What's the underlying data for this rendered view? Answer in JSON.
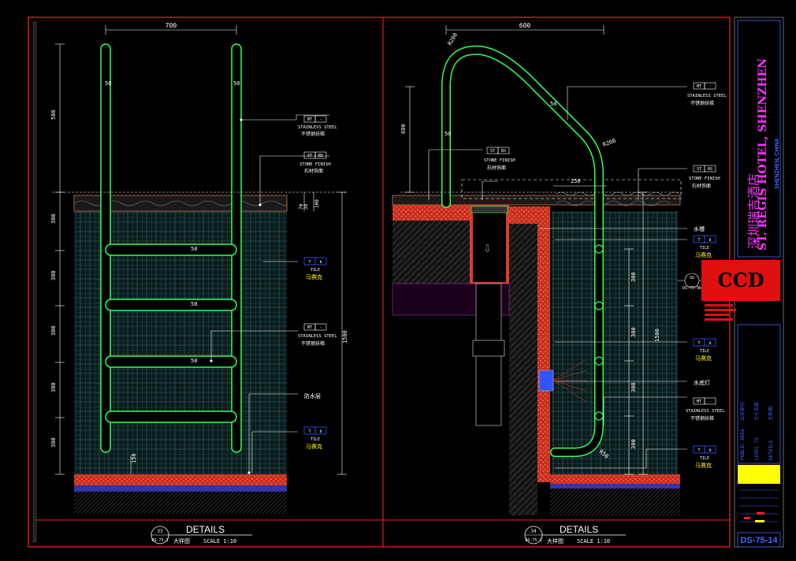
{
  "titles": {
    "left": {
      "number": "33",
      "ref": "DS-75-1",
      "name": "DETAILS",
      "sub": "大样图",
      "scale": "SCALE 1:10"
    },
    "right": {
      "number": "34",
      "ref": "DS-75-1",
      "name": "DETAILS",
      "sub": "大样图",
      "scale": "SCALE 1:10"
    }
  },
  "left_dims": {
    "top": "700",
    "left_pipe": "50",
    "right_pipe": "50",
    "vertical": [
      "500",
      "300",
      "300",
      "300",
      "300",
      "300"
    ],
    "rungs": [
      "50",
      "50",
      "50"
    ],
    "slab_a": "70",
    "slab_b": "30",
    "slab_c": "100",
    "total": "1500",
    "bottom": "150"
  },
  "left_tags": [
    {
      "code": "MT",
      "num": "-",
      "en": "STAINLESS STEEL",
      "cn": "不锈钢扶梯"
    },
    {
      "code": "ST",
      "num": "BS",
      "en": "STONE FINISH",
      "cn": "石材饰面"
    },
    {
      "code": "T",
      "num": "b",
      "en": "TILE",
      "cn": "马赛克"
    },
    {
      "code": "MT",
      "num": "-",
      "en": "STAINLESS STEEL",
      "cn": "不锈钢扶梯"
    },
    {
      "code": "",
      "num": "",
      "en": "",
      "cn": "防水层"
    },
    {
      "code": "T",
      "num": "b",
      "en": "TILE",
      "cn": "马赛克"
    }
  ],
  "right_dims": {
    "top": "600",
    "r1": "R200",
    "r2": "R200",
    "r3": "R200",
    "r4": "R50",
    "pipe": "50",
    "pipe2": "50",
    "height": "600",
    "w250": "250",
    "vertical": [
      "300",
      "300",
      "300",
      "300"
    ],
    "total": "1500"
  },
  "right_tags": [
    {
      "code": "MT",
      "num": "-",
      "en": "STAINLESS STEEL",
      "cn": "不锈钢扶梯"
    },
    {
      "code": "ST",
      "num": "BS",
      "en": "STONE FINISH",
      "cn": "石材饰面"
    },
    {
      "code": "ST",
      "num": "BS",
      "en": "STONE FINISH",
      "cn": "石材饰面"
    },
    {
      "code": "",
      "num": "",
      "en": "",
      "cn": "水槽"
    },
    {
      "code": "T",
      "num": "b",
      "en": "TILE",
      "cn": "马赛克"
    },
    {
      "code": "T",
      "num": "b",
      "en": "TILE",
      "cn": "马赛克"
    },
    {
      "code": "",
      "num": "",
      "en": "",
      "cn": "水底灯"
    },
    {
      "code": "MT",
      "num": "-",
      "en": "STAINLESS STEEL",
      "cn": "不锈钢扶梯"
    },
    {
      "code": "T",
      "num": "b",
      "en": "TILE",
      "cn": "马赛克"
    }
  ],
  "callout": {
    "num": "5b",
    "ref": "DS-75-9b"
  },
  "titleblock": {
    "hotel_cn": "深圳瑞吉酒店",
    "hotel_en": "ST. REGIS HOTEL, SHENZHEN",
    "city": "SHENZHEN, CHINA",
    "logo": "CCD",
    "area_en": "PUBLIC AREA",
    "area_cn": "公共部分",
    "level_en": "LEVEL 75",
    "level_cn": "七十五层",
    "details_en": "DETAILS",
    "details_cn": "大样图",
    "sheet": "DS-75-14"
  },
  "colors": {
    "frame": "#ff2222",
    "dim": "#ffffff",
    "pipe": "#33ff55",
    "tile": "#3a8a8a",
    "brick": "#e03a2a",
    "accent": "#ffff00",
    "magenta": "#ff33ff",
    "blue": "#4466ff"
  }
}
